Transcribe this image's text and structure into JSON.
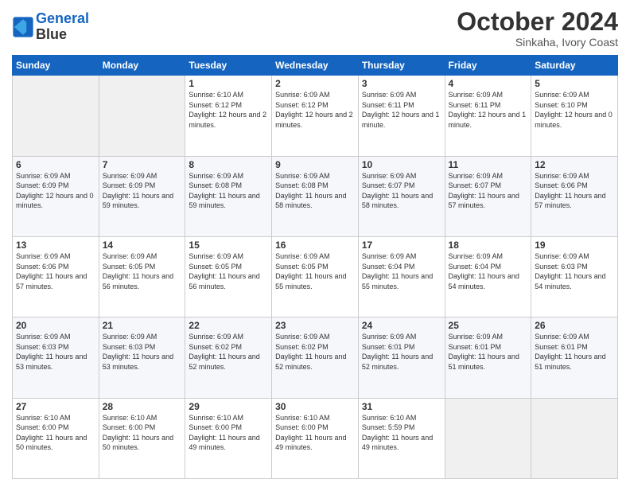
{
  "header": {
    "logo_line1": "General",
    "logo_line2": "Blue",
    "month": "October 2024",
    "location": "Sinkaha, Ivory Coast"
  },
  "weekdays": [
    "Sunday",
    "Monday",
    "Tuesday",
    "Wednesday",
    "Thursday",
    "Friday",
    "Saturday"
  ],
  "weeks": [
    [
      {
        "day": "",
        "info": ""
      },
      {
        "day": "",
        "info": ""
      },
      {
        "day": "1",
        "info": "Sunrise: 6:10 AM\nSunset: 6:12 PM\nDaylight: 12 hours and 2 minutes."
      },
      {
        "day": "2",
        "info": "Sunrise: 6:09 AM\nSunset: 6:12 PM\nDaylight: 12 hours and 2 minutes."
      },
      {
        "day": "3",
        "info": "Sunrise: 6:09 AM\nSunset: 6:11 PM\nDaylight: 12 hours and 1 minute."
      },
      {
        "day": "4",
        "info": "Sunrise: 6:09 AM\nSunset: 6:11 PM\nDaylight: 12 hours and 1 minute."
      },
      {
        "day": "5",
        "info": "Sunrise: 6:09 AM\nSunset: 6:10 PM\nDaylight: 12 hours and 0 minutes."
      }
    ],
    [
      {
        "day": "6",
        "info": "Sunrise: 6:09 AM\nSunset: 6:09 PM\nDaylight: 12 hours and 0 minutes."
      },
      {
        "day": "7",
        "info": "Sunrise: 6:09 AM\nSunset: 6:09 PM\nDaylight: 11 hours and 59 minutes."
      },
      {
        "day": "8",
        "info": "Sunrise: 6:09 AM\nSunset: 6:08 PM\nDaylight: 11 hours and 59 minutes."
      },
      {
        "day": "9",
        "info": "Sunrise: 6:09 AM\nSunset: 6:08 PM\nDaylight: 11 hours and 58 minutes."
      },
      {
        "day": "10",
        "info": "Sunrise: 6:09 AM\nSunset: 6:07 PM\nDaylight: 11 hours and 58 minutes."
      },
      {
        "day": "11",
        "info": "Sunrise: 6:09 AM\nSunset: 6:07 PM\nDaylight: 11 hours and 57 minutes."
      },
      {
        "day": "12",
        "info": "Sunrise: 6:09 AM\nSunset: 6:06 PM\nDaylight: 11 hours and 57 minutes."
      }
    ],
    [
      {
        "day": "13",
        "info": "Sunrise: 6:09 AM\nSunset: 6:06 PM\nDaylight: 11 hours and 57 minutes."
      },
      {
        "day": "14",
        "info": "Sunrise: 6:09 AM\nSunset: 6:05 PM\nDaylight: 11 hours and 56 minutes."
      },
      {
        "day": "15",
        "info": "Sunrise: 6:09 AM\nSunset: 6:05 PM\nDaylight: 11 hours and 56 minutes."
      },
      {
        "day": "16",
        "info": "Sunrise: 6:09 AM\nSunset: 6:05 PM\nDaylight: 11 hours and 55 minutes."
      },
      {
        "day": "17",
        "info": "Sunrise: 6:09 AM\nSunset: 6:04 PM\nDaylight: 11 hours and 55 minutes."
      },
      {
        "day": "18",
        "info": "Sunrise: 6:09 AM\nSunset: 6:04 PM\nDaylight: 11 hours and 54 minutes."
      },
      {
        "day": "19",
        "info": "Sunrise: 6:09 AM\nSunset: 6:03 PM\nDaylight: 11 hours and 54 minutes."
      }
    ],
    [
      {
        "day": "20",
        "info": "Sunrise: 6:09 AM\nSunset: 6:03 PM\nDaylight: 11 hours and 53 minutes."
      },
      {
        "day": "21",
        "info": "Sunrise: 6:09 AM\nSunset: 6:03 PM\nDaylight: 11 hours and 53 minutes."
      },
      {
        "day": "22",
        "info": "Sunrise: 6:09 AM\nSunset: 6:02 PM\nDaylight: 11 hours and 52 minutes."
      },
      {
        "day": "23",
        "info": "Sunrise: 6:09 AM\nSunset: 6:02 PM\nDaylight: 11 hours and 52 minutes."
      },
      {
        "day": "24",
        "info": "Sunrise: 6:09 AM\nSunset: 6:01 PM\nDaylight: 11 hours and 52 minutes."
      },
      {
        "day": "25",
        "info": "Sunrise: 6:09 AM\nSunset: 6:01 PM\nDaylight: 11 hours and 51 minutes."
      },
      {
        "day": "26",
        "info": "Sunrise: 6:09 AM\nSunset: 6:01 PM\nDaylight: 11 hours and 51 minutes."
      }
    ],
    [
      {
        "day": "27",
        "info": "Sunrise: 6:10 AM\nSunset: 6:00 PM\nDaylight: 11 hours and 50 minutes."
      },
      {
        "day": "28",
        "info": "Sunrise: 6:10 AM\nSunset: 6:00 PM\nDaylight: 11 hours and 50 minutes."
      },
      {
        "day": "29",
        "info": "Sunrise: 6:10 AM\nSunset: 6:00 PM\nDaylight: 11 hours and 49 minutes."
      },
      {
        "day": "30",
        "info": "Sunrise: 6:10 AM\nSunset: 6:00 PM\nDaylight: 11 hours and 49 minutes."
      },
      {
        "day": "31",
        "info": "Sunrise: 6:10 AM\nSunset: 5:59 PM\nDaylight: 11 hours and 49 minutes."
      },
      {
        "day": "",
        "info": ""
      },
      {
        "day": "",
        "info": ""
      }
    ]
  ]
}
